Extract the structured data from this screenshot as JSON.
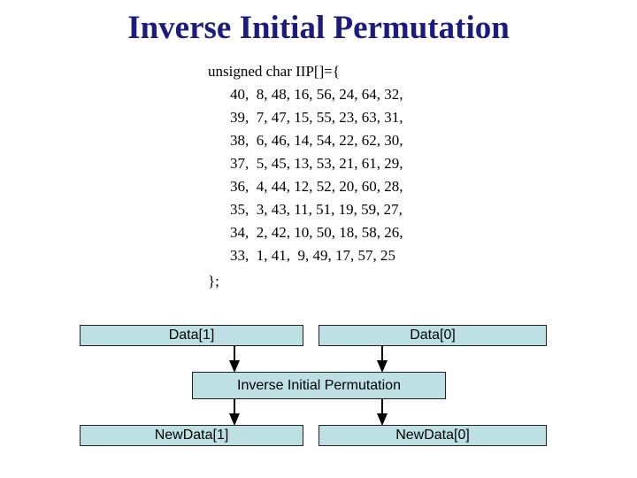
{
  "title": "Inverse Initial Permutation",
  "code": {
    "declaration": "unsigned char IIP[]={",
    "rows": [
      "40,  8, 48, 16, 56, 24, 64, 32,",
      "39,  7, 47, 15, 55, 23, 63, 31,",
      "38,  6, 46, 14, 54, 22, 62, 30,",
      "37,  5, 45, 13, 53, 21, 61, 29,",
      "36,  4, 44, 12, 52, 20, 60, 28,",
      "35,  3, 43, 11, 51, 19, 59, 27,",
      "34,  2, 42, 10, 50, 18, 58, 26,",
      "33,  1, 41,  9, 49, 17, 57, 25"
    ],
    "closing": "};"
  },
  "diagram": {
    "input_left": "Data[1]",
    "input_right": "Data[0]",
    "process": "Inverse Initial Permutation",
    "output_left": "NewData[1]",
    "output_right": "NewData[0]",
    "box_color": "#bde0e4"
  }
}
